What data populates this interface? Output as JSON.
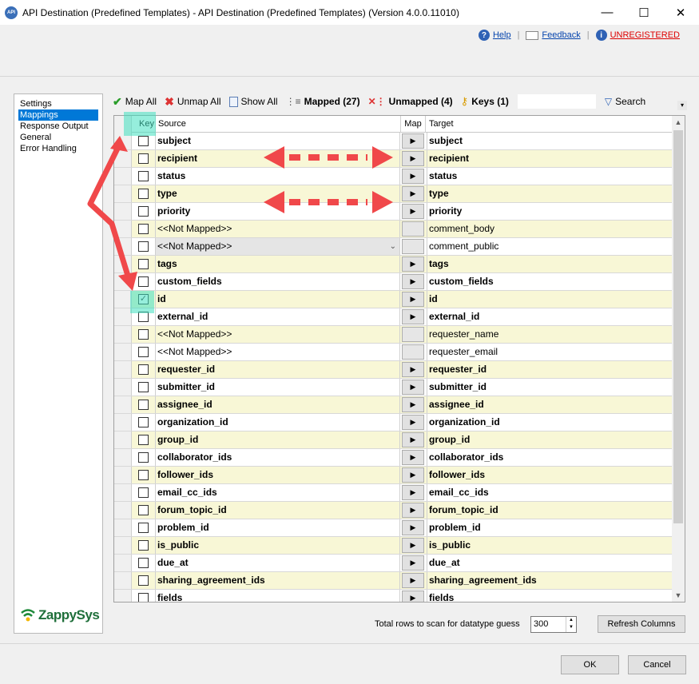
{
  "window": {
    "title": "API Destination (Predefined Templates) - API Destination (Predefined Templates) (Version 4.0.0.11010)",
    "app_icon_text": "API",
    "minimize": "—",
    "maximize": "☐",
    "close": "✕"
  },
  "links": {
    "help": "Help",
    "feedback": "Feedback",
    "unregistered": "UNREGISTERED"
  },
  "nav": {
    "items": [
      {
        "label": "Settings",
        "selected": false
      },
      {
        "label": "Mappings",
        "selected": true
      },
      {
        "label": "Response Output",
        "selected": false
      },
      {
        "label": "General",
        "selected": false
      },
      {
        "label": "Error Handling",
        "selected": false
      }
    ],
    "logo": "ZappySys"
  },
  "toolbar": {
    "map_all": "Map All",
    "unmap_all": "Unmap All",
    "show_all": "Show All",
    "mapped": "Mapped (27)",
    "unmapped": "Unmapped (4)",
    "keys": "Keys (1)",
    "search": "Search"
  },
  "grid": {
    "headers": {
      "key": "Key",
      "source": "Source",
      "map": "Map",
      "target": "Target"
    },
    "rows": [
      {
        "source": "subject",
        "target": "subject",
        "mapped": true,
        "key": false
      },
      {
        "source": "recipient",
        "target": "recipient",
        "mapped": true,
        "key": false
      },
      {
        "source": "status",
        "target": "status",
        "mapped": true,
        "key": false
      },
      {
        "source": "type",
        "target": "type",
        "mapped": true,
        "key": false
      },
      {
        "source": "priority",
        "target": "priority",
        "mapped": true,
        "key": false
      },
      {
        "source": "<<Not Mapped>>",
        "target": "comment_body",
        "mapped": false,
        "key": false
      },
      {
        "source": "<<Not Mapped>>",
        "target": "comment_public",
        "mapped": false,
        "key": false,
        "dropdown": true
      },
      {
        "source": "tags",
        "target": "tags",
        "mapped": true,
        "key": false
      },
      {
        "source": "custom_fields",
        "target": "custom_fields",
        "mapped": true,
        "key": false
      },
      {
        "source": "id",
        "target": "id",
        "mapped": true,
        "key": true
      },
      {
        "source": "external_id",
        "target": "external_id",
        "mapped": true,
        "key": false
      },
      {
        "source": "<<Not Mapped>>",
        "target": "requester_name",
        "mapped": false,
        "key": false
      },
      {
        "source": "<<Not Mapped>>",
        "target": "requester_email",
        "mapped": false,
        "key": false
      },
      {
        "source": "requester_id",
        "target": "requester_id",
        "mapped": true,
        "key": false
      },
      {
        "source": "submitter_id",
        "target": "submitter_id",
        "mapped": true,
        "key": false
      },
      {
        "source": "assignee_id",
        "target": "assignee_id",
        "mapped": true,
        "key": false
      },
      {
        "source": "organization_id",
        "target": "organization_id",
        "mapped": true,
        "key": false
      },
      {
        "source": "group_id",
        "target": "group_id",
        "mapped": true,
        "key": false
      },
      {
        "source": "collaborator_ids",
        "target": "collaborator_ids",
        "mapped": true,
        "key": false
      },
      {
        "source": "follower_ids",
        "target": "follower_ids",
        "mapped": true,
        "key": false
      },
      {
        "source": "email_cc_ids",
        "target": "email_cc_ids",
        "mapped": true,
        "key": false
      },
      {
        "source": "forum_topic_id",
        "target": "forum_topic_id",
        "mapped": true,
        "key": false
      },
      {
        "source": "problem_id",
        "target": "problem_id",
        "mapped": true,
        "key": false
      },
      {
        "source": "is_public",
        "target": "is_public",
        "mapped": true,
        "key": false
      },
      {
        "source": "due_at",
        "target": "due_at",
        "mapped": true,
        "key": false
      },
      {
        "source": "sharing_agreement_ids",
        "target": "sharing_agreement_ids",
        "mapped": true,
        "key": false
      },
      {
        "source": "fields",
        "target": "fields",
        "mapped": true,
        "key": false
      }
    ]
  },
  "footer": {
    "rows_label": "Total rows to scan for datatype guess",
    "rows_value": "300",
    "refresh": "Refresh Columns",
    "ok": "OK",
    "cancel": "Cancel"
  },
  "colors": {
    "accent": "#0078d7",
    "row_alt": "#f8f7d6",
    "highlight": "#40e0c0",
    "annotation_arrow": "#f0484a"
  }
}
